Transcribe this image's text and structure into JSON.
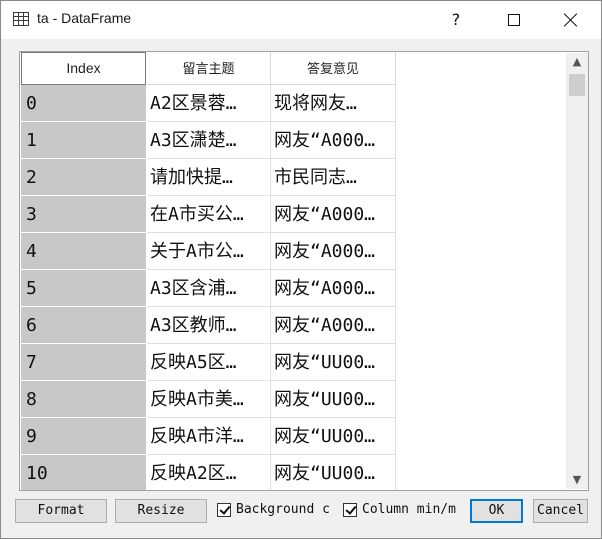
{
  "window": {
    "title": "ta - DataFrame",
    "controls": {
      "help": "?",
      "maximize": "maximize",
      "close": "close"
    }
  },
  "table": {
    "headers": {
      "index": "Index",
      "col1": "留言主题",
      "col2": "答复意见"
    },
    "rows": [
      {
        "index": "0",
        "col1": "A2区景蓉…",
        "col2": "现将网友…"
      },
      {
        "index": "1",
        "col1": "A3区潇楚…",
        "col2": "网友“A000…"
      },
      {
        "index": "2",
        "col1": "请加快提…",
        "col2": "市民同志…"
      },
      {
        "index": "3",
        "col1": "在A市买公…",
        "col2": "网友“A000…"
      },
      {
        "index": "4",
        "col1": "关于A市公…",
        "col2": "网友“A000…"
      },
      {
        "index": "5",
        "col1": "A3区含浦…",
        "col2": "网友“A000…"
      },
      {
        "index": "6",
        "col1": "A3区教师…",
        "col2": "网友“A000…"
      },
      {
        "index": "7",
        "col1": "反映A5区…",
        "col2": "网友“UU00…"
      },
      {
        "index": "8",
        "col1": "反映A市美…",
        "col2": "网友“UU00…"
      },
      {
        "index": "9",
        "col1": "反映A市洋…",
        "col2": "网友“UU00…"
      },
      {
        "index": "10",
        "col1": "反映A2区…",
        "col2": "网友“UU00…"
      }
    ]
  },
  "footer": {
    "format_label": "Format",
    "resize_label": "Resize",
    "background_label": "Background c",
    "background_checked": true,
    "minmax_label": "Column min/m",
    "minmax_checked": true,
    "ok_label": "OK",
    "cancel_label": "Cancel"
  },
  "icons": {
    "app": "table-icon",
    "scroll_up": "chevron-up-icon",
    "scroll_down": "chevron-down-icon"
  }
}
